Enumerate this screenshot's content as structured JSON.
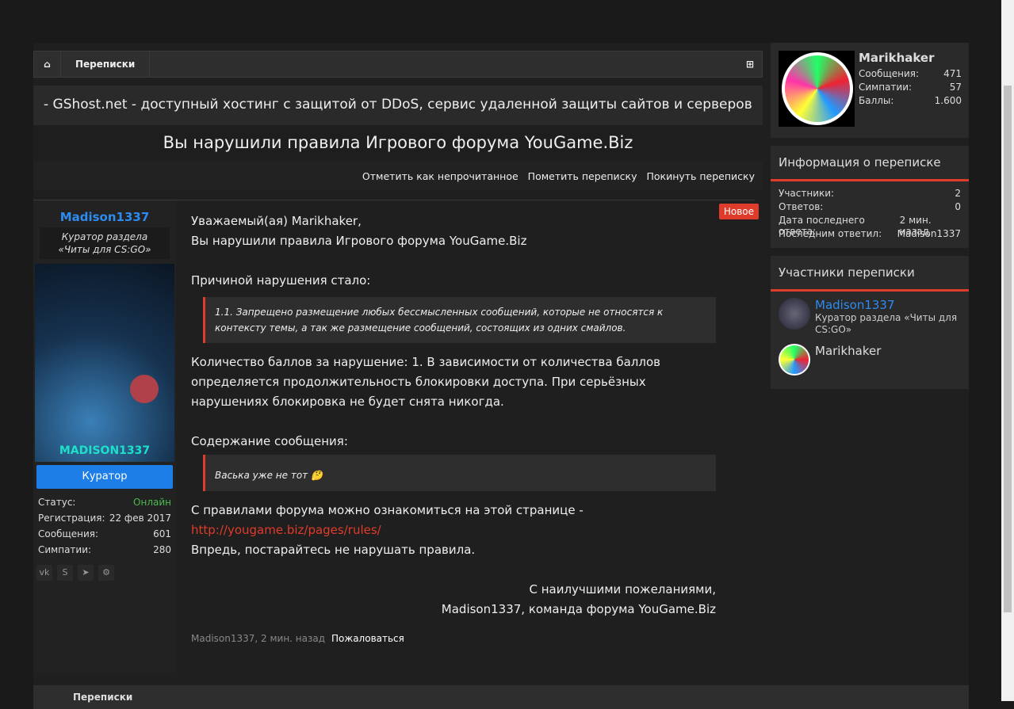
{
  "breadcrumb": {
    "home_icon": "home-icon",
    "current": "Переписки",
    "sitemap_icon": "sitemap-icon"
  },
  "notice": "- GShost.net - доступный хостинг с защитой от DDoS, сервис удаленной защиты сайтов и серверов",
  "title": "Вы нарушили правила Игрового форума YouGame.Biz",
  "actions": [
    "Отметить как непрочитанное",
    "Пометить переписку",
    "Покинуть переписку"
  ],
  "author": {
    "name": "Madison1337",
    "title": "Куратор раздела «Читы для CS:GO»",
    "avatar_text": "MADISON1337",
    "badge": "Куратор",
    "stats": [
      {
        "label": "Статус:",
        "value": "Онлайн"
      },
      {
        "label": "Регистрация:",
        "value": "22 фев 2017"
      },
      {
        "label": "Сообщения:",
        "value": "601"
      },
      {
        "label": "Симпатии:",
        "value": "280"
      }
    ],
    "social": [
      "vk-icon",
      "skype-icon",
      "telegram-icon",
      "steam-icon"
    ]
  },
  "message": {
    "new_badge": "Новое",
    "greeting": "Уважаемый(ая) Marikhaker,",
    "line2": "Вы нарушили правила Игрового форума YouGame.Biz",
    "reason_label": "Причиной нарушения стало:",
    "reason": "1.1. Запрещено размещение любых бессмысленных сообщений, которые не относятся к контексту темы, а так же размещение сообщений, состоящих из одних смайлов.",
    "points": "Количество баллов за нарушение: 1. В зависимости от количества баллов определяется продолжительность блокировки доступа. При серьёзных нарушениях блокировка не будет снята никогда.",
    "content_label": "Содержание сообщения:",
    "content": "Васька уже не тот",
    "rules_text": "С правилами форума можно ознакомиться на этой странице -",
    "rules_link": "http://yougame.biz/pages/rules/",
    "closing": "Впредь, постарайтесь не нарушать правила.",
    "sig1": "С наилучшими пожеланиями,",
    "sig2": "Madison1337, команда форума YouGame.Biz",
    "meta": "Madison1337, 2 мин. назад",
    "report": "Пожаловаться"
  },
  "me": {
    "name": "Marikhaker",
    "stats": [
      {
        "label": "Сообщения:",
        "value": "471"
      },
      {
        "label": "Симпатии:",
        "value": "57"
      },
      {
        "label": "Баллы:",
        "value": "1.600"
      }
    ]
  },
  "info": {
    "heading": "Информация о переписке",
    "rows": [
      {
        "label": "Участники:",
        "value": "2"
      },
      {
        "label": "Ответов:",
        "value": "0"
      },
      {
        "label": "Дата последнего ответа:",
        "value": "2 мин. назад"
      },
      {
        "label": "Последним ответил:",
        "value": "Madison1337"
      }
    ]
  },
  "participants": {
    "heading": "Участники переписки",
    "list": [
      {
        "name": "Madison1337",
        "title": "Куратор раздела «Читы для CS:GO»"
      },
      {
        "name": "Marikhaker"
      }
    ]
  },
  "footer": {
    "current": "Переписки"
  }
}
